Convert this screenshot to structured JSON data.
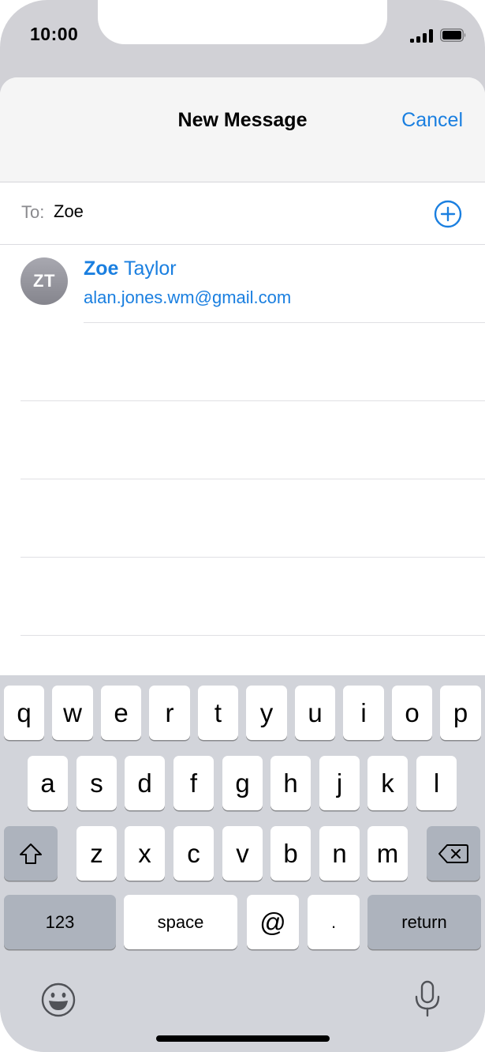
{
  "status_bar": {
    "time": "10:00"
  },
  "nav": {
    "title": "New Message",
    "cancel_label": "Cancel"
  },
  "to_field": {
    "label": "To:",
    "value": "Zoe"
  },
  "suggestion": {
    "initials": "ZT",
    "name_match": "Zoe",
    "name_rest": " Taylor",
    "email": "alan.jones.wm@gmail.com"
  },
  "keyboard": {
    "row1": [
      "q",
      "w",
      "e",
      "r",
      "t",
      "y",
      "u",
      "i",
      "o",
      "p"
    ],
    "row2": [
      "a",
      "s",
      "d",
      "f",
      "g",
      "h",
      "j",
      "k",
      "l"
    ],
    "row3": [
      "z",
      "x",
      "c",
      "v",
      "b",
      "n",
      "m"
    ],
    "numbers_label": "123",
    "space_label": "space",
    "at_label": "@",
    "dot_label": ".",
    "return_label": "return"
  },
  "icons": {
    "add": "plus-circle-icon",
    "shift": "shift-icon",
    "delete": "backspace-icon",
    "emoji": "emoji-icon",
    "dictation": "microphone-icon"
  },
  "colors": {
    "accent": "#1a7fe0",
    "keyboard_bg": "#d2d4da",
    "dark_key": "#adb3bd"
  }
}
